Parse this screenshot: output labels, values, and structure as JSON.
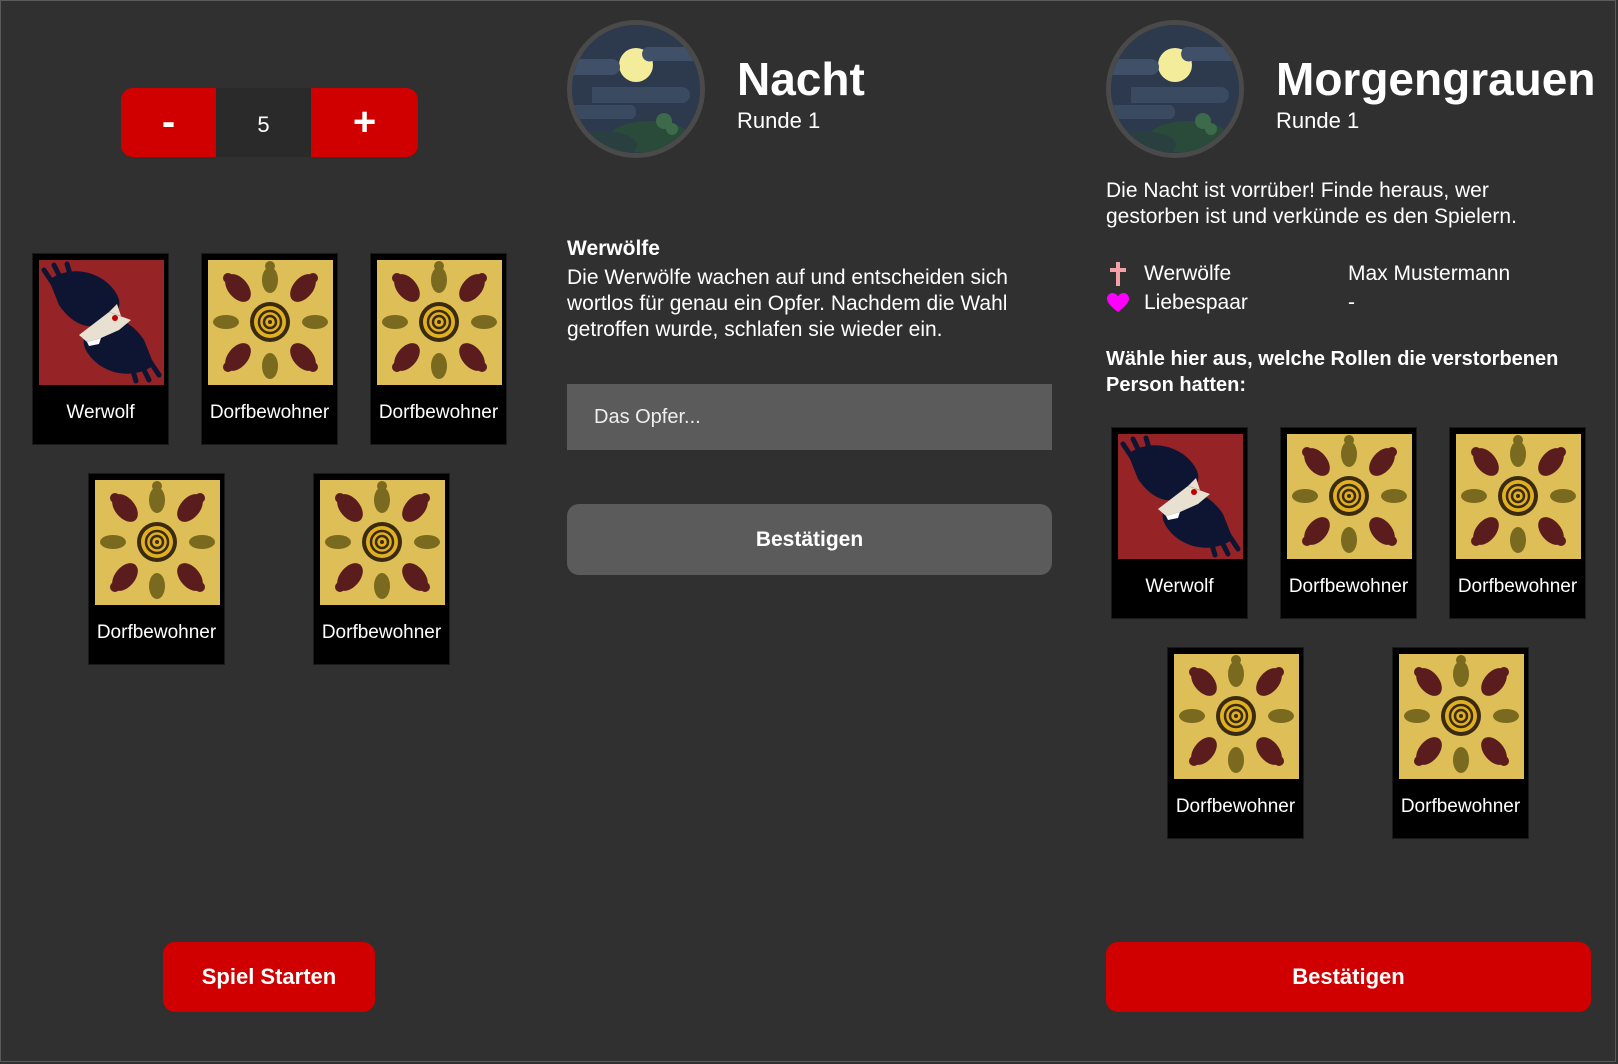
{
  "setup": {
    "stepper": {
      "minus_label": "-",
      "value": "5",
      "plus_label": "+"
    },
    "cards": [
      {
        "role": "werwolf",
        "label": "Werwolf"
      },
      {
        "role": "dorfbewohner",
        "label": "Dorfbewohner"
      },
      {
        "role": "dorfbewohner",
        "label": "Dorfbewohner"
      },
      {
        "role": "dorfbewohner",
        "label": "Dorfbewohner"
      },
      {
        "role": "dorfbewohner",
        "label": "Dorfbewohner"
      }
    ],
    "start_button": "Spiel Starten"
  },
  "night": {
    "title": "Nacht",
    "round": "Runde 1",
    "role_title": "Werwölfe",
    "role_description": "Die Werwölfe wachen auf und entscheiden sich wortlos für genau ein Opfer. Nachdem die Wahl getroffen wurde, schlafen sie wieder ein.",
    "victim_placeholder": "Das Opfer...",
    "confirm_button": "Bestätigen"
  },
  "dawn": {
    "title": "Morgengrauen",
    "round": "Runde 1",
    "intro": "Die Nacht ist vorrüber! Finde heraus, wer gestorben ist und verkünde es den Spielern.",
    "deaths": [
      {
        "icon": "cross-icon",
        "cause": "Werwölfe",
        "name": "Max Mustermann"
      },
      {
        "icon": "heart-icon",
        "cause": "Liebespaar",
        "name": "-"
      }
    ],
    "choose_prompt": "Wähle hier aus, welche Rollen die verstorbenen Person hatten:",
    "cards": [
      {
        "role": "werwolf",
        "label": "Werwolf"
      },
      {
        "role": "dorfbewohner",
        "label": "Dorfbewohner"
      },
      {
        "role": "dorfbewohner",
        "label": "Dorfbewohner"
      },
      {
        "role": "dorfbewohner",
        "label": "Dorfbewohner"
      },
      {
        "role": "dorfbewohner",
        "label": "Dorfbewohner"
      }
    ],
    "confirm_button": "Bestätigen"
  },
  "colors": {
    "background": "#303030",
    "accent_red": "#d00000",
    "neutral_button": "#5b5b5b",
    "cross_icon": "#f4a0a8",
    "heart_icon": "#ff00ff"
  }
}
